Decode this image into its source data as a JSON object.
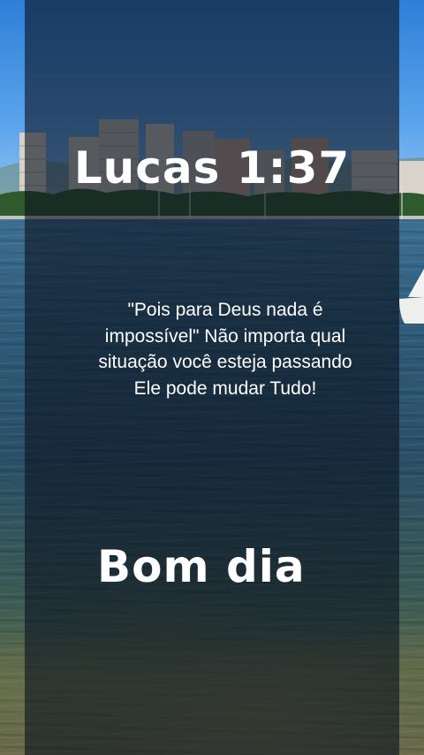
{
  "story": {
    "reference": "Lucas 1:37",
    "verse": "\"Pois para Deus nada é impossível\" Não importa qual situação você esteja passando Ele pode mudar Tudo!",
    "greeting": "Bom dia"
  },
  "background": {
    "scene": "city-skyline-over-bay-photo"
  },
  "colors": {
    "text": "#ffffff",
    "overlay": "#0c1420",
    "sky": "#5aa3ec",
    "water": "#2e5a78"
  }
}
